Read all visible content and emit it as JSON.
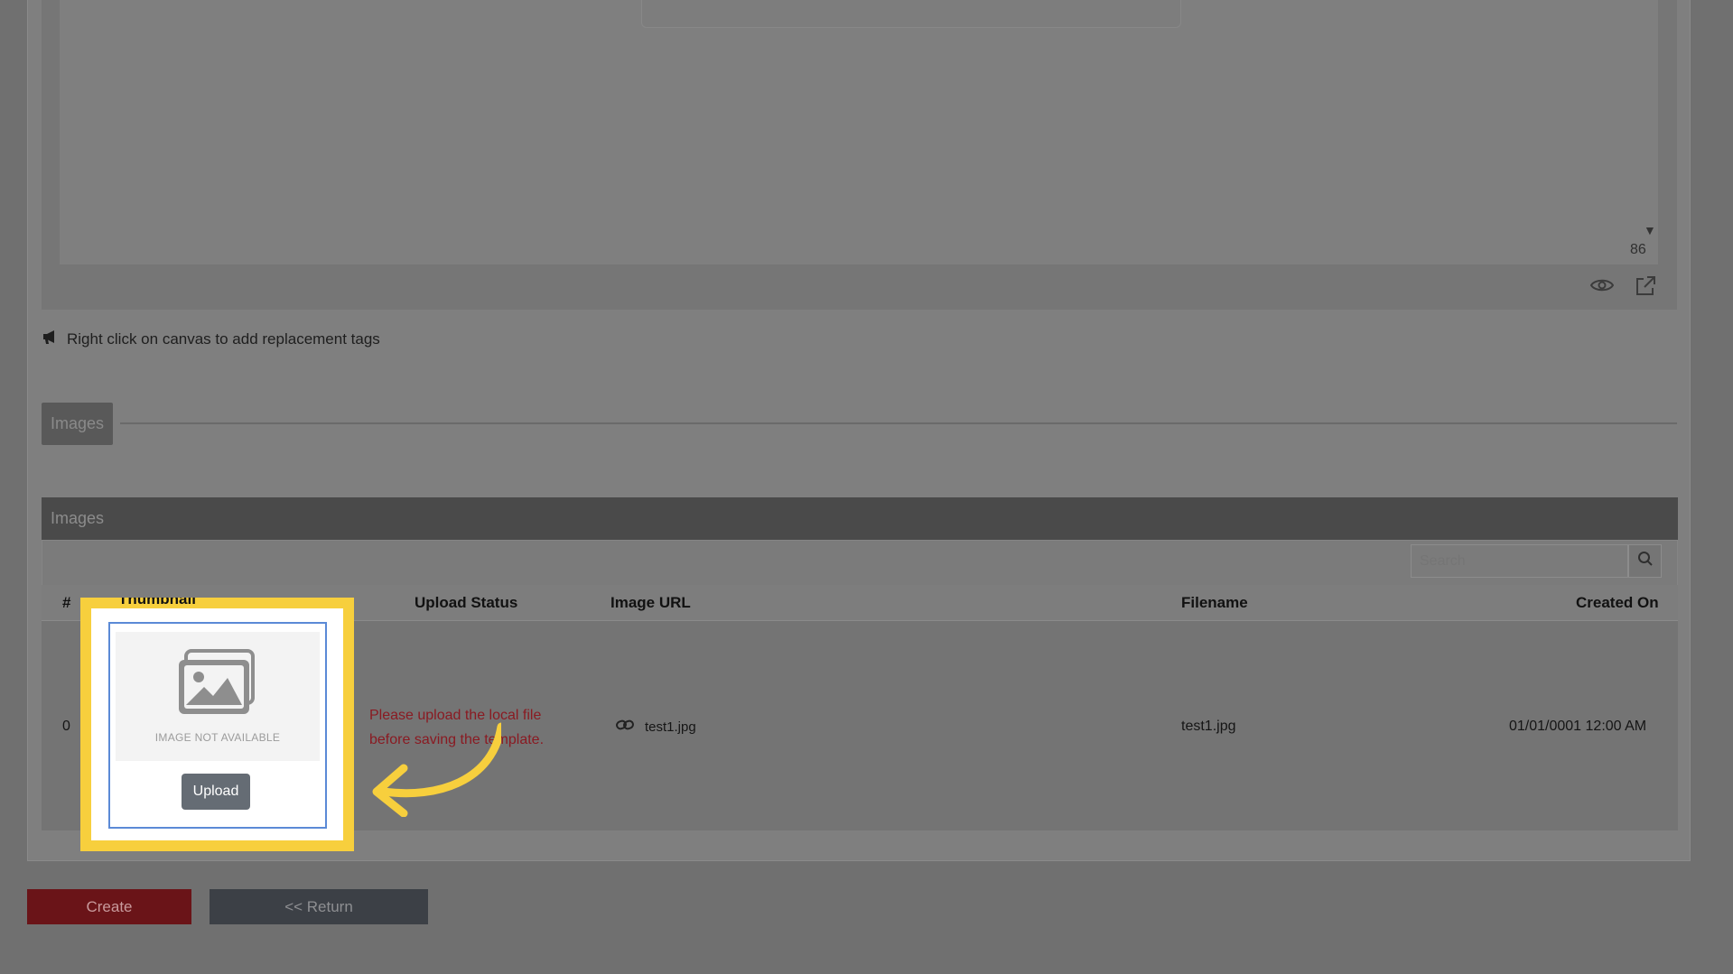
{
  "editor": {
    "line_count": "86",
    "hint": "Right click on canvas to add replacement tags"
  },
  "images_section": {
    "tab_label": "Images",
    "panel_title": "Images",
    "search": {
      "placeholder": "Search"
    },
    "columns": {
      "index": "#",
      "thumbnail": "Thumbnail",
      "upload_status": "Upload Status",
      "image_url": "Image URL",
      "filename": "Filename",
      "created_on": "Created On"
    },
    "rows": [
      {
        "index": "0",
        "thumbnail_text": "IMAGE NOT AVAILABLE",
        "upload_button": "Upload",
        "upload_status": "Please upload the local file before saving the template.",
        "image_url": "test1.jpg",
        "filename": "test1.jpg",
        "created_on": "01/01/0001 12:00 AM"
      }
    ]
  },
  "actions": {
    "create": "Create",
    "return": "<< Return"
  },
  "colors": {
    "highlight": "#f7cf3d",
    "error": "#8a1a22",
    "create_button": "#6a1418"
  }
}
